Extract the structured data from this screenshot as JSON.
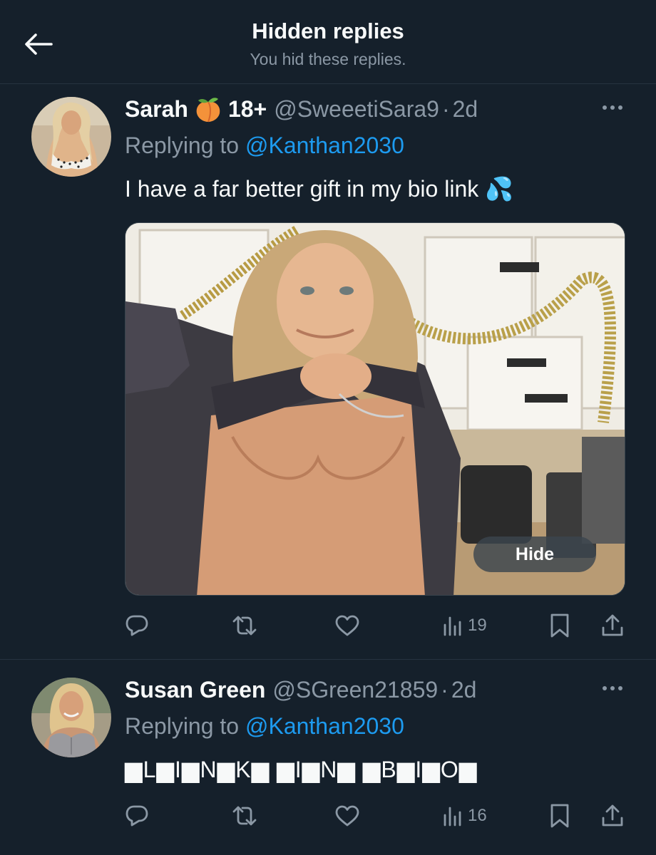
{
  "header": {
    "title": "Hidden replies",
    "subtitle": "You hid these replies."
  },
  "tweets": [
    {
      "display_name": "Sarah",
      "badge": "18+",
      "handle": "@SweeetiSara9",
      "dot": "·",
      "time": "2d",
      "replying_prefix": "Replying to",
      "replying_to": "@Kanthan2030",
      "text": "I have a far better gift in my bio link 💦",
      "media": {
        "hide_label": "Hide"
      },
      "views": "19"
    },
    {
      "display_name": "Susan Green",
      "handle": "@SGreen21859",
      "dot": "·",
      "time": "2d",
      "replying_prefix": "Replying to",
      "replying_to": "@Kanthan2030",
      "text": "▆L▆I▆N▆K▆ ▆I▆N▆ ▆B▆I▆O▆",
      "views": "16"
    }
  ],
  "colors": {
    "background": "#15202b",
    "secondary_text": "#8b98a5",
    "link": "#1d9bf0",
    "divider": "#263340"
  },
  "icons": [
    "back-arrow-icon",
    "more-icon",
    "reply-icon",
    "retweet-icon",
    "like-icon",
    "views-icon",
    "bookmark-icon",
    "share-icon",
    "peach-emoji-icon"
  ]
}
